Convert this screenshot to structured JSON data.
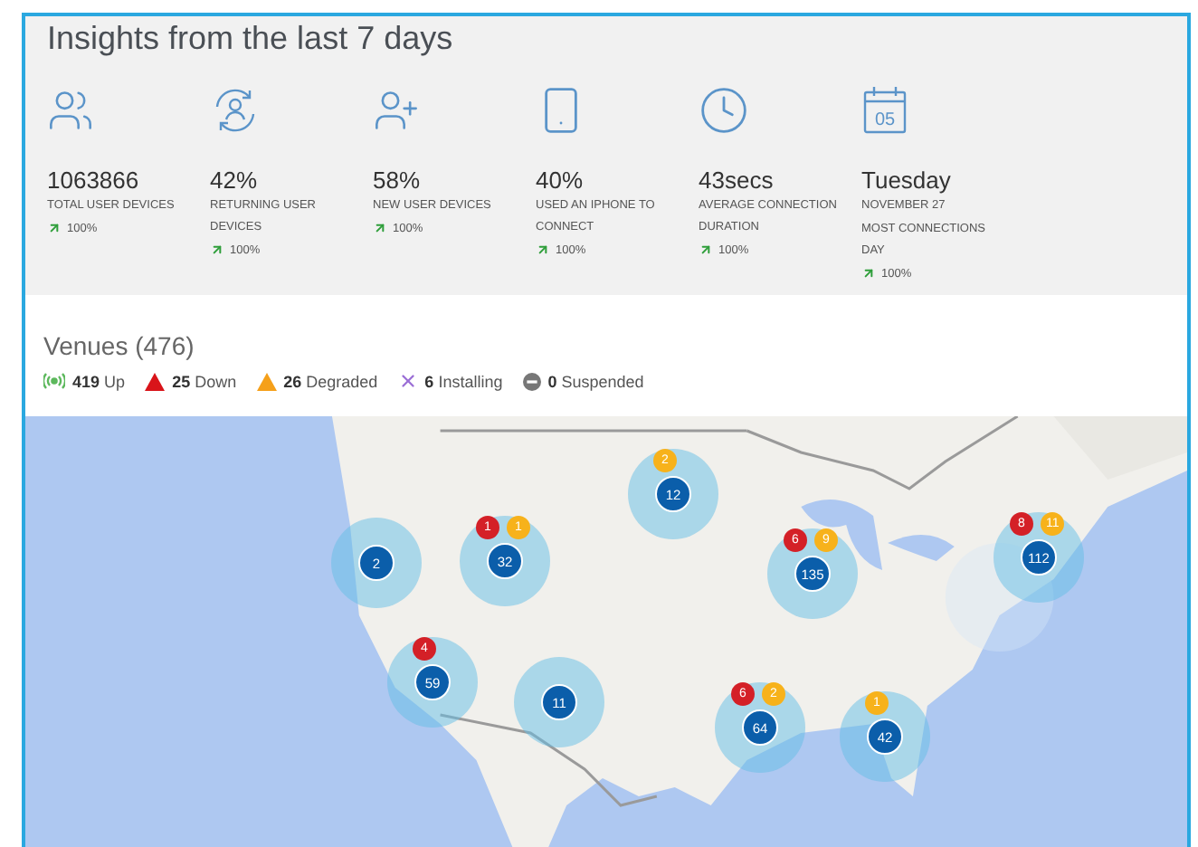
{
  "insights": {
    "title": "Insights from the last 7 days",
    "stats": [
      {
        "kind": "users",
        "value": "1063866",
        "label": "TOTAL USER DEVICES",
        "trend": "100%"
      },
      {
        "kind": "returning",
        "value": "42%",
        "label": "RETURNING USER DEVICES",
        "trend": "100%"
      },
      {
        "kind": "new-users",
        "value": "58%",
        "label": "NEW USER DEVICES",
        "trend": "100%"
      },
      {
        "kind": "phone",
        "value": "40%",
        "label": "USED AN IPHONE TO CONNECT",
        "trend": "100%"
      },
      {
        "kind": "clock",
        "value": "43secs",
        "label": "AVERAGE CONNECTION DURATION",
        "trend": "100%"
      },
      {
        "kind": "calendar",
        "icon_text": "05",
        "value": "Tuesday",
        "sublabel": "NOVEMBER 27",
        "label": "MOST CONNECTIONS DAY",
        "trend": "100%"
      }
    ]
  },
  "venues": {
    "title": "Venues (476)",
    "legend": [
      {
        "kind": "up",
        "count": "419",
        "label": "Up"
      },
      {
        "kind": "down",
        "count": "25",
        "label": "Down"
      },
      {
        "kind": "degraded",
        "count": "26",
        "label": "Degraded"
      },
      {
        "kind": "installing",
        "count": "6",
        "label": "Installing"
      },
      {
        "kind": "suspended",
        "count": "0",
        "label": "Suspended"
      }
    ]
  },
  "map": {
    "clusters": [
      {
        "count": "2"
      },
      {
        "count": "32",
        "down": "1",
        "degraded": "1"
      },
      {
        "count": "12",
        "degraded": "2"
      },
      {
        "count": "135",
        "down": "6",
        "degraded": "9"
      },
      {
        "count": "112",
        "down": "8",
        "degraded": "11"
      },
      {
        "count": "59",
        "down": "4"
      },
      {
        "count": "11"
      },
      {
        "count": "64",
        "down": "6",
        "degraded": "2"
      },
      {
        "count": "42",
        "degraded": "1"
      }
    ]
  }
}
